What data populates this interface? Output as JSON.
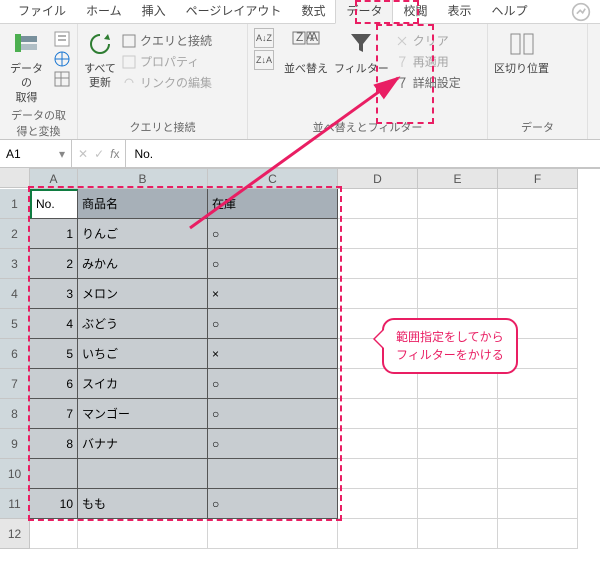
{
  "tabs": {
    "file": "ファイル",
    "home": "ホーム",
    "insert": "挿入",
    "pageLayout": "ページレイアウト",
    "formulas": "数式",
    "data": "データ",
    "review": "校閲",
    "view": "表示",
    "help": "ヘルプ"
  },
  "ribbon": {
    "getData": "データの\n取得",
    "getDataGroup": "データの取得と変換",
    "refresh": "すべて\n更新",
    "queries": "クエリと接続",
    "properties": "プロパティ",
    "editLinks": "リンクの編集",
    "queriesGroup": "クエリと接続",
    "sort": "並べ替え",
    "filter": "フィルター",
    "clear": "クリア",
    "reapply": "再適用",
    "advanced": "詳細設定",
    "sortFilterGroup": "並べ替えとフィルター",
    "textToCol": "区切り位置",
    "dataToolsGroup": "データ"
  },
  "nameBox": "A1",
  "formula": "No.",
  "colWidths": {
    "A": 48,
    "B": 130,
    "C": 130,
    "D": 80,
    "E": 80,
    "F": 80
  },
  "headers": [
    "No.",
    "商品名",
    "在庫"
  ],
  "rows": [
    {
      "no": 1,
      "name": "りんご",
      "stock": "○"
    },
    {
      "no": 2,
      "name": "みかん",
      "stock": "○"
    },
    {
      "no": 3,
      "name": "メロン",
      "stock": "×"
    },
    {
      "no": 4,
      "name": "ぶどう",
      "stock": "○"
    },
    {
      "no": 5,
      "name": "いちご",
      "stock": "×"
    },
    {
      "no": 6,
      "name": "スイカ",
      "stock": "○"
    },
    {
      "no": 7,
      "name": "マンゴー",
      "stock": "○"
    },
    {
      "no": 8,
      "name": "バナナ",
      "stock": "○"
    },
    {
      "no": "",
      "name": "",
      "stock": ""
    },
    {
      "no": 10,
      "name": "もも",
      "stock": "○"
    }
  ],
  "callout": {
    "line1": "範囲指定をしてから",
    "line2": "フィルターをかける"
  }
}
